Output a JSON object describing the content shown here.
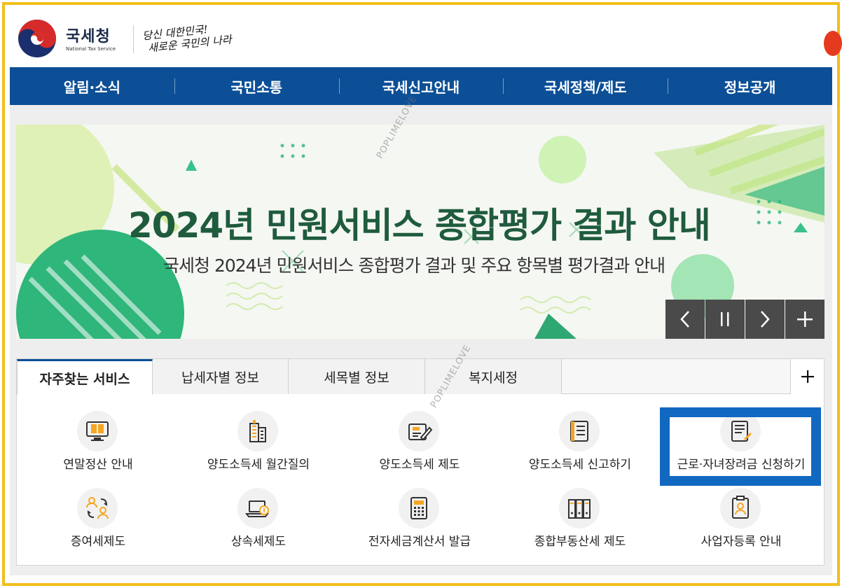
{
  "header": {
    "logo_kr": "국세청",
    "logo_en": "National Tax Service",
    "slogan_line1": "당신 대한민국!",
    "slogan_line2": "새로운 국민의 나라"
  },
  "nav": {
    "items": [
      "알림·소식",
      "국민소통",
      "국세신고안내",
      "국세정책/제도",
      "정보공개"
    ]
  },
  "banner": {
    "title": "2024년 민원서비스 종합평가 결과 안내",
    "subtitle": "국세청 2024년 민원서비스 종합평가 결과 및 주요 항목별 평가결과 안내",
    "controls": [
      "prev",
      "pause",
      "next",
      "more"
    ]
  },
  "tabs": {
    "items": [
      "자주찾는 서비스",
      "납세자별 정보",
      "세목별 정보",
      "복지세정"
    ],
    "active": "자주찾는 서비스",
    "plus": "+"
  },
  "services": [
    {
      "label": "연말정산 안내",
      "icon": "monitor-book-icon"
    },
    {
      "label": "양도소득세 월간질의",
      "icon": "building-icon"
    },
    {
      "label": "양도소득세 제도",
      "icon": "pencil-document-icon"
    },
    {
      "label": "양도소득세 신고하기",
      "icon": "document-list-icon"
    },
    {
      "label": "근로·자녀장려금 신청하기",
      "icon": "document-pen-icon"
    },
    {
      "label": "증여세제도",
      "icon": "people-exchange-icon"
    },
    {
      "label": "상속세제도",
      "icon": "laptop-coin-icon"
    },
    {
      "label": "전자세금계산서 발급",
      "icon": "calculator-icon"
    },
    {
      "label": "종합부동산세 제도",
      "icon": "binders-icon"
    },
    {
      "label": "사업자등록 안내",
      "icon": "id-card-icon"
    }
  ],
  "watermark": "POPLIMELOVE",
  "colors": {
    "frame": "#f2be1a",
    "nav": "#0c4f96",
    "banner_title": "#1f5b3d",
    "highlight": "#1068c1"
  }
}
